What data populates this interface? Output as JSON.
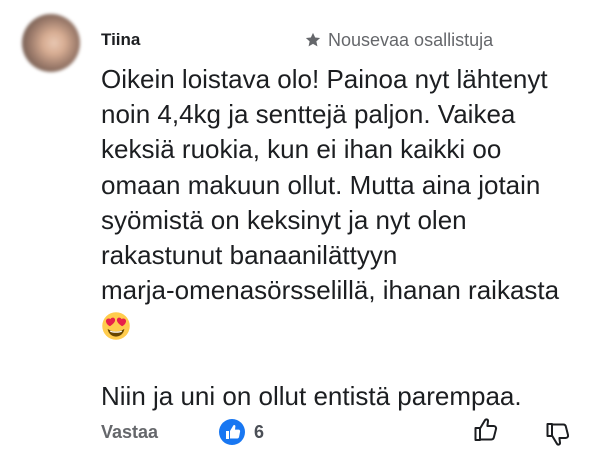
{
  "comment": {
    "author": "Tiina",
    "badge": "Nousevaa osallistuja",
    "badge_icon": "star-icon",
    "lines": [
      "Oikein loistava olo! Painoa nyt lähtenyt",
      "noin 4,4kg ja senttejä paljon. Vaikea",
      "keksiä ruokia, kun ei ihan kaikki oo",
      "omaan makuun ollut. Mutta aina jotain",
      "syömistä on keksinyt ja nyt olen",
      "rakastunut banaanilättyyn",
      "marja-omenasörsselillä, ihanan raikasta"
    ],
    "emoji": "heart-eyes-emoji",
    "closing_line": "Niin ja uni on ollut entistä parempaa."
  },
  "actions": {
    "reply_label": "Vastaa",
    "like_count": "6",
    "like_badge_icon": "like-badge-icon",
    "upvote_icon": "thumbs-up-icon",
    "downvote_icon": "thumbs-down-icon"
  },
  "colors": {
    "text": "#1c1e21",
    "secondary": "#65676b",
    "like_blue": "#1877f2",
    "emoji_yellow": "#ffcc4d",
    "emoji_heart": "#e8214a"
  }
}
